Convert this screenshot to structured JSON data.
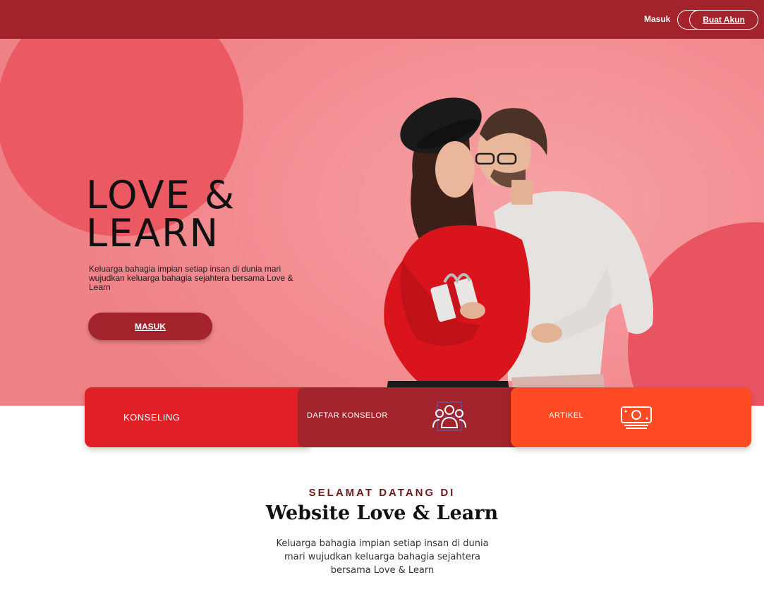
{
  "nav": {
    "login_label": "Masuk",
    "register_label": "Buat Akun"
  },
  "hero": {
    "title_line1": "LOVE &",
    "title_line2": "LEARN",
    "description": "Keluarga bahagia impian setiap insan di dunia mari wujudkan keluarga bahagia sejahtera bersama Love & Learn",
    "button_label": "MASUK",
    "image": "couple-photo"
  },
  "services": [
    {
      "label": "KONSELING",
      "icon": "",
      "color": "#e11f27"
    },
    {
      "label": "DAFTAR KONSELOR",
      "icon": "users-icon",
      "color": "#a3232c"
    },
    {
      "label": "ARTIKEL",
      "icon": "money-icon",
      "color": "#ff4a23"
    }
  ],
  "welcome": {
    "kicker": "SELAMAT DATANG DI",
    "title": "Website Love & Learn",
    "description": "Keluarga bahagia impian setiap insan di dunia mari wujudkan keluarga bahagia sejahtera bersama Love & Learn"
  },
  "colors": {
    "topbar": "#a3232c",
    "hero_bg": "#f38d92",
    "accent_circle": "#eb5a62",
    "primary_button": "#a3232c"
  }
}
